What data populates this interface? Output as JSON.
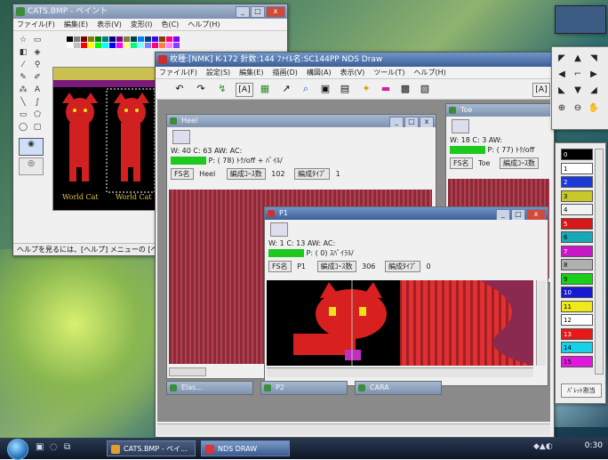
{
  "paint": {
    "title": "CATS.BMP - ペイント",
    "menu": [
      "ファイル(F)",
      "編集(E)",
      "表示(V)",
      "変形(I)",
      "色(C)",
      "ヘルプ(H)"
    ],
    "status": "ヘルプを見るには、[ヘルプ] メニューの [ヘ",
    "canvas_text": [
      "World Cat",
      "World Cat"
    ]
  },
  "nds": {
    "title": "枚種:[NMK] K-172  針数:144 ﾌｧｲﾙ名:SC144PP NDS Draw",
    "menu": [
      "ファイル(F)",
      "設定(S)",
      "編集(E)",
      "描画(D)",
      "構図(A)",
      "表示(V)",
      "ツール(T)",
      "ヘルプ(H)"
    ],
    "toolbar_text": "[A]"
  },
  "heel": {
    "title": "Heel",
    "row1": "W:  40   C:  63    AW:        AC:",
    "row2": "P: ( 78) ﾄｸ/off + ﾊﾞｲﾙ/",
    "name_label": "FS名",
    "name_value": "Heel",
    "course_label": "編成ｺｰｽ数",
    "course_value": "102",
    "type_label": "編成ﾀｲﾌﾟ",
    "type_value": "1"
  },
  "toe": {
    "title": "Toe",
    "row1": "W:  18   C:  3    AW:",
    "row2": "P: ( 77) ﾄｸ/off",
    "name_label": "FS名",
    "name_value": "Toe",
    "course_label": "編成ｺｰｽ数"
  },
  "p1": {
    "title": "P1",
    "row1": "W:  1   C:  13    AW:        AC:",
    "row2": "P: ( 0) ｽﾊﾟｲﾗﾙ/",
    "name_label": "FS名",
    "name_value": "P1",
    "course_label": "編成ｺｰｽ数",
    "course_value": "306",
    "type_label": "編成ﾀｲﾌﾟ",
    "type_value": "0"
  },
  "minimized": [
    "Elas...",
    "P2",
    "CARA"
  ],
  "palette": {
    "swatches": [
      {
        "label": "0",
        "color": "#000000"
      },
      {
        "label": "1",
        "color": "#ffffff"
      },
      {
        "label": "2",
        "color": "#1a3ad8"
      },
      {
        "label": "3",
        "color": "#c8c828"
      },
      {
        "label": "4",
        "color": "#f2f2f2"
      },
      {
        "label": "5",
        "color": "#d81818"
      },
      {
        "label": "6",
        "color": "#18a8b8"
      },
      {
        "label": "7",
        "color": "#c818c8"
      },
      {
        "label": "8",
        "color": "#b0b0b0"
      },
      {
        "label": "9",
        "color": "#18d018"
      },
      {
        "label": "10",
        "color": "#1818d0"
      },
      {
        "label": "11",
        "color": "#f0e818"
      },
      {
        "label": "12",
        "color": "#ffffff"
      },
      {
        "label": "13",
        "color": "#e81818"
      },
      {
        "label": "14",
        "color": "#18d0e8"
      },
      {
        "label": "15",
        "color": "#e018e0"
      }
    ],
    "button": "ﾊﾟﾚｯﾄ割当"
  },
  "taskbar": {
    "tasks": [
      "CATS.BMP - ペイ...",
      "NDS DRAW"
    ],
    "clock": "0:30"
  }
}
